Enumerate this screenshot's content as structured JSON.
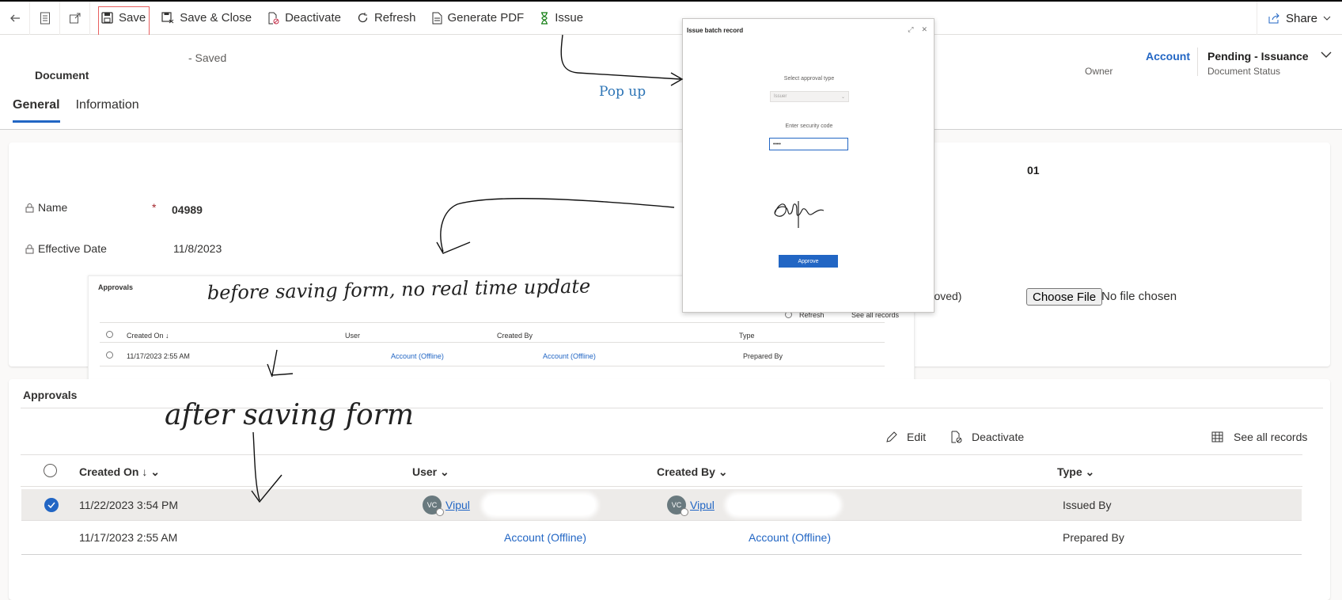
{
  "toolbar": {
    "save": "Save",
    "save_close": "Save & Close",
    "deactivate": "Deactivate",
    "refresh": "Refresh",
    "generate_pdf": "Generate PDF",
    "issue": "Issue",
    "share": "Share"
  },
  "header": {
    "saved_status": "- Saved",
    "entity": "Document",
    "owner_value": "Account",
    "owner_label": "Owner",
    "status_value": "Pending - Issuance",
    "status_label": "Document Status"
  },
  "tabs": [
    "General",
    "Information"
  ],
  "form": {
    "name_label": "Name",
    "name_value": "04989",
    "date_label": "Effective Date",
    "date_value": "11/8/2023",
    "right_value": "01",
    "approved_fragment": "proved)",
    "choose_file": "Choose File",
    "no_file": "No file chosen"
  },
  "inset": {
    "title": "Approvals",
    "refresh": "Refresh",
    "see_all": "See all records",
    "columns": [
      "Created On ↓",
      "User",
      "Created By",
      "Type"
    ],
    "row": {
      "created_on": "11/17/2023 2:55 AM",
      "user": "Account (Offline)",
      "created_by": "Account (Offline)",
      "type": "Prepared By"
    }
  },
  "popup": {
    "title": "Issue batch record",
    "approval_type_label": "Select approval type",
    "approval_type_value": "Issuer",
    "security_code_label": "Enter security code",
    "security_code_value": "••••",
    "approve": "Approve",
    "annotation": "Pop up"
  },
  "annotations": {
    "before": "before saving form, no real time update",
    "after": "after saving form"
  },
  "approvals": {
    "title": "Approvals",
    "edit": "Edit",
    "deactivate": "Deactivate",
    "see_all": "See all records",
    "columns": [
      "Created On ↓",
      "User",
      "Created By",
      "Type"
    ],
    "rows": [
      {
        "created_on": "11/22/2023 3:54 PM",
        "user": "Vipul",
        "user_initials": "VC",
        "created_by": "Vipul",
        "created_by_initials": "VC",
        "type": "Issued By",
        "selected": true
      },
      {
        "created_on": "11/17/2023 2:55 AM",
        "user": "Account (Offline)",
        "created_by": "Account (Offline)",
        "type": "Prepared By",
        "selected": false
      }
    ]
  }
}
